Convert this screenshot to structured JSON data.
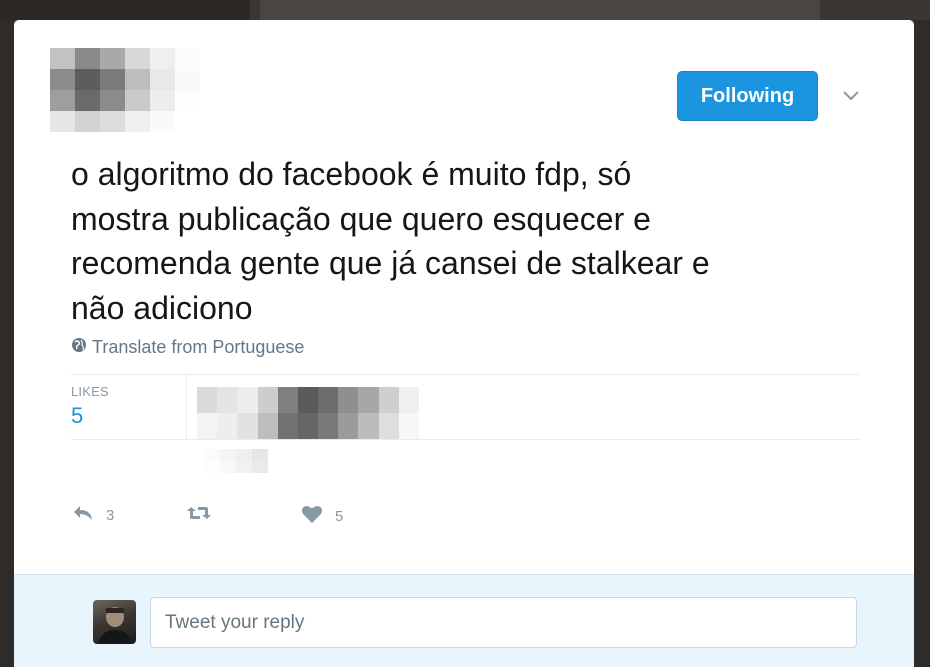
{
  "header": {
    "follow_button_label": "Following",
    "menu_icon": "chevron-down-icon"
  },
  "tweet": {
    "text_lines": [
      "o algoritmo do facebook é muito fdp, só",
      "mostra publicação que quero esquecer e",
      "recomenda gente que já cansei de stalkear e",
      "não adiciono"
    ],
    "translate_label": "Translate from Portuguese",
    "translate_icon": "globe-icon"
  },
  "stats": {
    "likes_label": "LIKES",
    "likes_count": "5"
  },
  "actions": {
    "reply_count": "3",
    "like_count": "5",
    "reply_icon": "reply-icon",
    "retweet_icon": "retweet-icon",
    "like_icon": "heart-icon"
  },
  "reply": {
    "placeholder": "Tweet your reply"
  },
  "colors": {
    "accent": "#1b95e0",
    "muted_text": "#8899a6",
    "reply_bg": "#e8f5fd"
  }
}
